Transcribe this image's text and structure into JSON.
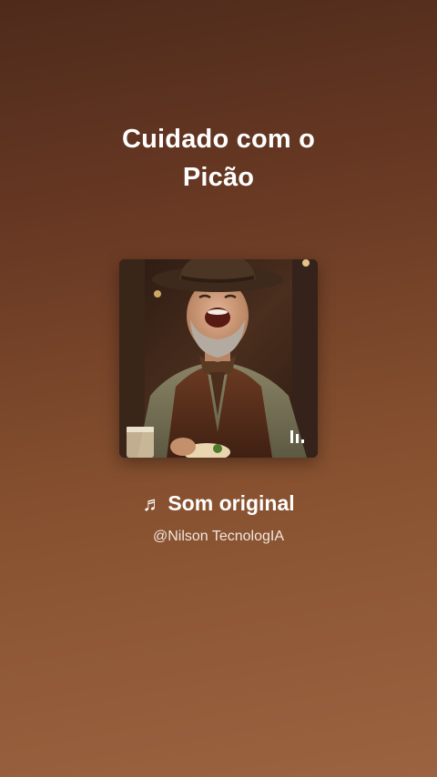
{
  "title": {
    "line1": "Cuidado com o",
    "line2": "Picão"
  },
  "cover": {
    "icon": "audio-bars-icon",
    "subject": "laughing-cowboy-artwork"
  },
  "sound": {
    "icon": "music-note-icon",
    "icon_glyph": "♬",
    "label": "Som original"
  },
  "author": {
    "handle": "@Nilson TecnologIA"
  },
  "colors": {
    "bg_top": "#4e2a1b",
    "bg_bottom": "#9c6340",
    "text": "#ffffff"
  }
}
